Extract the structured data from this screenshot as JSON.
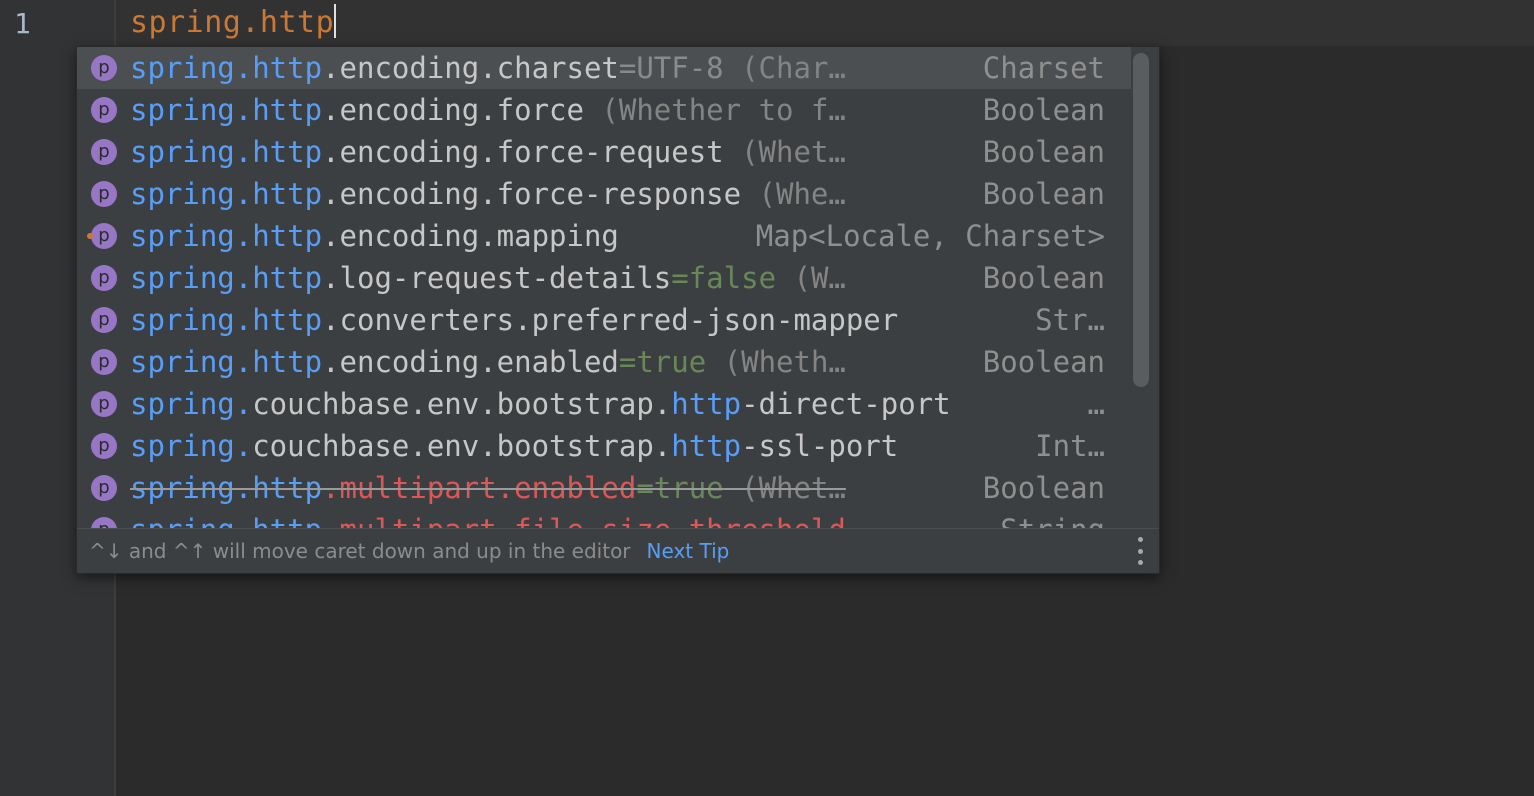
{
  "editor": {
    "line_number": "1",
    "code_text": "spring.http"
  },
  "popup": {
    "icon_letter": "p",
    "rows": [
      {
        "hl": "spring.http",
        "rest": ".encoding.charset",
        "val": "=UTF-8",
        "tail": " (Char…",
        "type": "Charset"
      },
      {
        "hl": "spring.http",
        "rest": ".encoding.force",
        "val": "",
        "tail": " (Whether to f…",
        "type": "Boolean"
      },
      {
        "hl": "spring.http",
        "rest": ".encoding.force-request",
        "val": "",
        "tail": " (Whet…",
        "type": "Boolean"
      },
      {
        "hl": "spring.http",
        "rest": ".encoding.force-response",
        "val": "",
        "tail": " (Whe…",
        "type": "Boolean"
      },
      {
        "hl": "spring.http",
        "rest": ".encoding.mapping",
        "val": "",
        "tail": "",
        "type": "Map<Locale, Charset>"
      },
      {
        "hl": "spring.http",
        "rest": ".log-request-details",
        "val": "=false",
        "tail": " (W…",
        "type": "Boolean"
      },
      {
        "hl": "spring.http",
        "rest": ".converters.preferred-json-mapper",
        "val": "",
        "tail": "",
        "type": "Str…"
      },
      {
        "hl": "spring.http",
        "rest": ".encoding.enabled",
        "val": "=true",
        "tail": " (Wheth…",
        "type": "Boolean"
      },
      {
        "hl1": "spring.",
        "mid": "couchbase.env.bootstrap.",
        "hl2": "http",
        "rest": "-direct-port",
        "type": "…"
      },
      {
        "hl1": "spring.",
        "mid": "couchbase.env.bootstrap.",
        "hl2": "http",
        "rest": "-ssl-port",
        "type": "Int…"
      },
      {
        "hl": "spring.http",
        "rest": ".multipart.enabled",
        "val": "=true",
        "tail": " (Whet…",
        "type": "Boolean",
        "deprecated": true
      },
      {
        "hl": "spring.http",
        "rest": ".multipart.file-size-threshold",
        "val": "",
        "tail": "",
        "type": "String",
        "deprecated": true
      }
    ],
    "footer": {
      "tip": "^↓ and ^↑ will move caret down and up in the editor",
      "next_tip": "Next Tip"
    }
  },
  "colors": {
    "background": "#2b2b2b",
    "popup": "#3c3f41",
    "match_highlight": "#589df6",
    "keyword_orange": "#cc7832",
    "value_green": "#6a8759",
    "deprecated_red": "#e05555",
    "icon_purple": "#9876c6"
  }
}
